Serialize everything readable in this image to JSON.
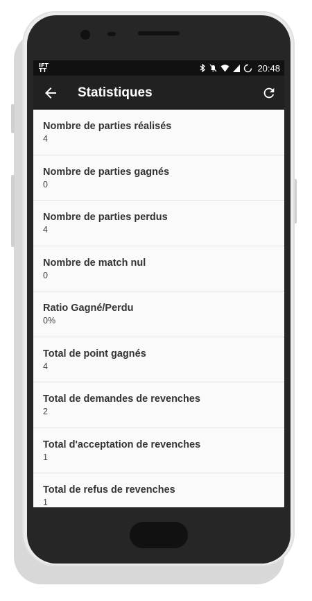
{
  "status_bar": {
    "left_icon_text": "IFT TT",
    "time": "20:48",
    "icons": [
      "bluetooth-icon",
      "mute-icon",
      "wifi-icon",
      "signal-icon",
      "sync-icon"
    ]
  },
  "app_bar": {
    "title": "Statistiques",
    "back_icon": "arrow-back-icon",
    "refresh_icon": "refresh-icon"
  },
  "stats": [
    {
      "label": "Nombre de parties réalisés",
      "value": "4"
    },
    {
      "label": "Nombre de parties gagnés",
      "value": "0"
    },
    {
      "label": "Nombre de parties perdus",
      "value": "4"
    },
    {
      "label": "Nombre de match nul",
      "value": "0"
    },
    {
      "label": "Ratio Gagné/Perdu",
      "value": "0%"
    },
    {
      "label": "Total de point gagnés",
      "value": "4"
    },
    {
      "label": "Total de demandes de revenches",
      "value": "2"
    },
    {
      "label": "Total d'acceptation de revenches",
      "value": "1"
    },
    {
      "label": "Total de refus de revenches",
      "value": "1"
    }
  ],
  "colors": {
    "app_bar": "#212121",
    "status_bar": "#111111",
    "background": "#fafafa",
    "phone_body": "#262626"
  }
}
